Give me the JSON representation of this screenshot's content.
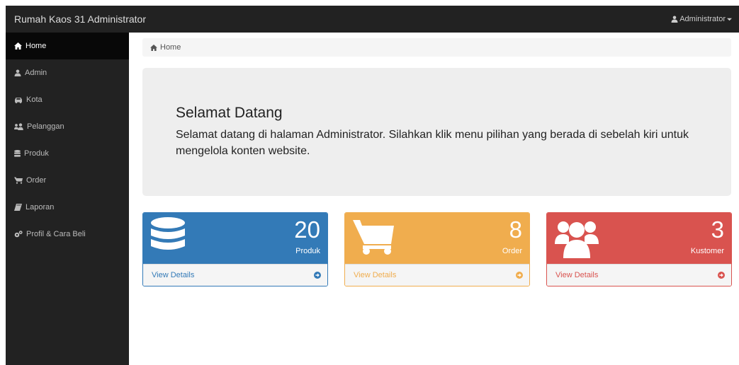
{
  "topbar": {
    "brand": "Rumah Kaos 31 Administrator",
    "user": "Administrator"
  },
  "sidebar": {
    "items": [
      {
        "label": "Home",
        "icon": "home-icon",
        "active": true
      },
      {
        "label": "Admin",
        "icon": "user-icon"
      },
      {
        "label": "Kota",
        "icon": "car-icon"
      },
      {
        "label": "Pelanggan",
        "icon": "users-icon"
      },
      {
        "label": "Produk",
        "icon": "database-icon"
      },
      {
        "label": "Order",
        "icon": "cart-icon"
      },
      {
        "label": "Laporan",
        "icon": "book-icon"
      },
      {
        "label": "Profil & Cara Beli",
        "icon": "cogs-icon"
      }
    ]
  },
  "breadcrumb": {
    "home": "Home"
  },
  "welcome": {
    "title": "Selamat Datang",
    "text": "Selamat datang di halaman Administrator. Silahkan klik menu pilihan yang berada di sebelah kiri untuk mengelola konten website."
  },
  "panels": [
    {
      "count": "20",
      "label": "Produk",
      "link": "View Details",
      "icon": "database-icon",
      "color": "#337ab7"
    },
    {
      "count": "8",
      "label": "Order",
      "link": "View Details",
      "icon": "cart-icon",
      "color": "#f0ad4e"
    },
    {
      "count": "3",
      "label": "Kustomer",
      "link": "View Details",
      "icon": "users-icon",
      "color": "#d9534f"
    }
  ],
  "colors": {
    "navbar": "#222222",
    "sidebar_active": "#080808"
  }
}
